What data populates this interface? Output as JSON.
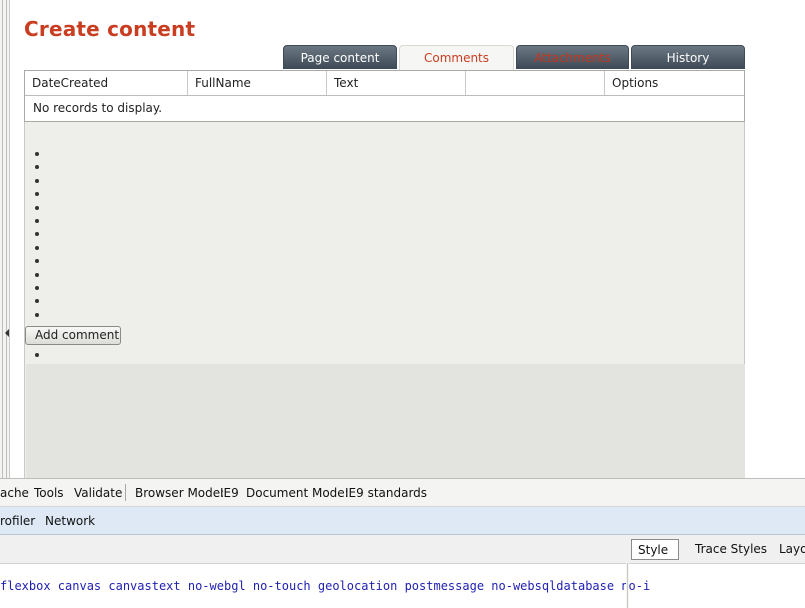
{
  "page": {
    "title": "Create content"
  },
  "tabs": [
    {
      "label": "Page content",
      "state": "dark"
    },
    {
      "label": "Comments",
      "state": "active"
    },
    {
      "label": "Attachments",
      "state": "dark-red"
    },
    {
      "label": "History",
      "state": "dark"
    }
  ],
  "grid": {
    "columns": [
      "DateCreated",
      "FullName",
      "Text",
      "",
      "Options"
    ],
    "empty_message": "No records to display."
  },
  "form": {
    "bullet_count": 16,
    "add_button_label": "Add comment"
  },
  "devtools": {
    "menu": {
      "cache": "ache",
      "tools": "Tools",
      "validate": "Validate",
      "browser_mode_label": "Browser Mode:",
      "browser_mode_value": "IE9",
      "document_mode_label": "Document Mode:",
      "document_mode_value": "IE9 standards"
    },
    "tabs": {
      "profiler": "rofiler",
      "network": "Network"
    },
    "side_tabs": {
      "style": "Style",
      "trace_styles": "Trace Styles",
      "layout": "Layo"
    },
    "code_line": "flexbox canvas canvastext no-webgl no-touch geolocation postmessage no-websqldatabase no-i"
  },
  "colors": {
    "title": "#c93d21",
    "tab_dark": "#3f4b57",
    "tab_active_text": "#c93d21",
    "code_text": "#1f1fb3"
  }
}
